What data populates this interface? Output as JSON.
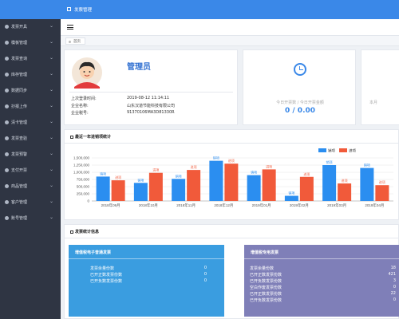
{
  "topbar": {
    "title": "发票管理"
  },
  "sidebar": {
    "items": [
      {
        "label": "发票开具"
      },
      {
        "label": "模板管理"
      },
      {
        "label": "发票查询"
      },
      {
        "label": "库存管理"
      },
      {
        "label": "数据同步"
      },
      {
        "label": "抄报上传"
      },
      {
        "label": "清卡管理"
      },
      {
        "label": "发票查验"
      },
      {
        "label": "发票预警"
      },
      {
        "label": "支付开票"
      },
      {
        "label": "商品管理"
      },
      {
        "label": "客户管理"
      },
      {
        "label": "账号管理"
      }
    ]
  },
  "tabs": {
    "home": "首页"
  },
  "profile": {
    "name": "管理员",
    "rows": [
      {
        "label": "上次登录时间:",
        "value": "2019-08-12 11:14:11"
      },
      {
        "label": "企业名称:",
        "value": "山东汉道节能科技有限公司"
      },
      {
        "label": "企业税号:",
        "value": "91370106MA3D81330R"
      }
    ]
  },
  "stats": {
    "today_label": "今日开票数 / 今日开票金额",
    "today_value": "0 / 0.00",
    "partial_label": "本月"
  },
  "chart_section": {
    "title": "最近一年进销项统计"
  },
  "chart_data": {
    "type": "bar",
    "title": "",
    "categories": [
      "2018年09月",
      "2018年10月",
      "2018年11月",
      "2018年12月",
      "2019年01月",
      "2019年02月",
      "2019年03月",
      "2019年04月"
    ],
    "series": [
      {
        "name": "销项",
        "color": "#2b8ef0",
        "values": [
          850000,
          630000,
          770000,
          1400000,
          900000,
          180000,
          1250000,
          1150000
        ]
      },
      {
        "name": "进项",
        "color": "#f15a3a",
        "values": [
          720000,
          980000,
          1080000,
          1300000,
          1100000,
          840000,
          610000,
          550000
        ]
      }
    ],
    "yticks": [
      "0",
      "250,000",
      "500,000",
      "750,000",
      "1,000,000",
      "1,250,000",
      "1,500,000"
    ],
    "ylim": [
      0,
      1500000
    ],
    "legend": [
      "销项",
      "进项"
    ],
    "legend_position": "top-right",
    "grid": true
  },
  "invoice_section": {
    "title": "发票统计信息"
  },
  "panels": {
    "blue": {
      "title": "增值税电子普通发票",
      "color": "#3a9de0",
      "rows": [
        {
          "label": "发票余量份数",
          "value": "0"
        },
        {
          "label": "已开正数发票份数",
          "value": "0"
        },
        {
          "label": "已开负数发票份数",
          "value": "0"
        }
      ]
    },
    "purple": {
      "title": "增值税专用发票",
      "color": "#7f7fb8",
      "rows": [
        {
          "label": "发票余量份数",
          "value": "18"
        },
        {
          "label": "已开正数发票份数",
          "value": "421"
        },
        {
          "label": "已开负数发票份数",
          "value": "3"
        },
        {
          "label": "空白作废发票份数",
          "value": "0"
        },
        {
          "label": "已开正数发票份数",
          "value": "22"
        },
        {
          "label": "已开负数发票份数",
          "value": "0"
        }
      ]
    }
  }
}
